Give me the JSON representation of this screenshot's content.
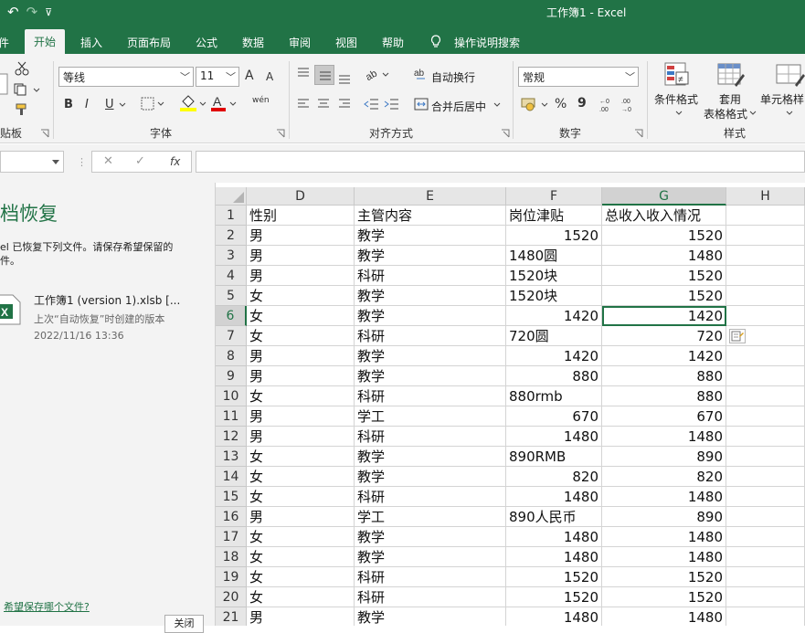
{
  "window": {
    "title": "工作簿1  -  Excel"
  },
  "qat": {
    "undo": "↶",
    "redo": "↷",
    "customize": "⊽"
  },
  "tabs": [
    "件",
    "开始",
    "插入",
    "页面布局",
    "公式",
    "数据",
    "审阅",
    "视图",
    "帮助",
    "操作说明搜索"
  ],
  "ribbon": {
    "clipboard": {
      "title": "贴板"
    },
    "font": {
      "name": "等线",
      "size": "11",
      "title": "字体",
      "bold": "B",
      "italic": "I",
      "underline": "U",
      "grow": "A",
      "shrink": "A",
      "wen": "wén"
    },
    "alignment": {
      "wrap": "自动换行",
      "merge": "合并后居中",
      "title": "对齐方式"
    },
    "number": {
      "format": "常规",
      "title": "数字",
      "percent": "%",
      "comma": "9"
    },
    "styles": {
      "conditional": "条件格式",
      "table_l1": "套用",
      "table_l2": "表格格式",
      "cell": "单元格样",
      "title": "样式"
    }
  },
  "formula_bar": {
    "fx": "fx",
    "cancel": "✕",
    "enter": "✓"
  },
  "recovery": {
    "title": "档恢复",
    "desc_l1": "el 已恢复下列文件。请保存希望保留的",
    "desc_l2": "件。",
    "file_name": "工作簿1 (version 1).xlsb  [...",
    "file_sub": "上次“自动恢复”时创建的版本",
    "file_time": "2022/11/16 13:36",
    "link": "希望保存哪个文件?",
    "close": "关闭"
  },
  "sheet": {
    "columns": [
      "D",
      "E",
      "F",
      "G",
      "H"
    ],
    "rows": [
      {
        "n": "1",
        "d": "性别",
        "e": "主管内容",
        "f": "岗位津贴",
        "f_num": false,
        "g": "总收入收入情况",
        "g_num": false
      },
      {
        "n": "2",
        "d": "男",
        "e": "教学",
        "f": "1520",
        "f_num": true,
        "g": "1520",
        "g_num": true
      },
      {
        "n": "3",
        "d": "男",
        "e": "教学",
        "f": "1480圆",
        "f_num": false,
        "g": "1480",
        "g_num": true
      },
      {
        "n": "4",
        "d": "男",
        "e": "科研",
        "f": "1520块",
        "f_num": false,
        "g": "1520",
        "g_num": true
      },
      {
        "n": "5",
        "d": "女",
        "e": "教学",
        "f": "1520块",
        "f_num": false,
        "g": "1520",
        "g_num": true
      },
      {
        "n": "6",
        "d": "女",
        "e": "教学",
        "f": "1420",
        "f_num": true,
        "g": "1420",
        "g_num": true
      },
      {
        "n": "7",
        "d": "女",
        "e": "科研",
        "f": "720圆",
        "f_num": false,
        "g": "720",
        "g_num": true
      },
      {
        "n": "8",
        "d": "男",
        "e": "教学",
        "f": "1420",
        "f_num": true,
        "g": "1420",
        "g_num": true
      },
      {
        "n": "9",
        "d": "男",
        "e": "教学",
        "f": "880",
        "f_num": true,
        "g": "880",
        "g_num": true
      },
      {
        "n": "10",
        "d": "女",
        "e": "科研",
        "f": "880rmb",
        "f_num": false,
        "g": "880",
        "g_num": true
      },
      {
        "n": "11",
        "d": "男",
        "e": "学工",
        "f": "670",
        "f_num": true,
        "g": "670",
        "g_num": true
      },
      {
        "n": "12",
        "d": "男",
        "e": "科研",
        "f": "1480",
        "f_num": true,
        "g": "1480",
        "g_num": true
      },
      {
        "n": "13",
        "d": "女",
        "e": "教学",
        "f": "890RMB",
        "f_num": false,
        "g": "890",
        "g_num": true
      },
      {
        "n": "14",
        "d": "女",
        "e": "教学",
        "f": "820",
        "f_num": true,
        "g": "820",
        "g_num": true
      },
      {
        "n": "15",
        "d": "女",
        "e": "科研",
        "f": "1480",
        "f_num": true,
        "g": "1480",
        "g_num": true
      },
      {
        "n": "16",
        "d": "男",
        "e": "学工",
        "f": "890人民币",
        "f_num": false,
        "g": "890",
        "g_num": true
      },
      {
        "n": "17",
        "d": "女",
        "e": "教学",
        "f": "1480",
        "f_num": true,
        "g": "1480",
        "g_num": true
      },
      {
        "n": "18",
        "d": "女",
        "e": "教学",
        "f": "1480",
        "f_num": true,
        "g": "1480",
        "g_num": true
      },
      {
        "n": "19",
        "d": "女",
        "e": "科研",
        "f": "1520",
        "f_num": true,
        "g": "1520",
        "g_num": true
      },
      {
        "n": "20",
        "d": "女",
        "e": "科研",
        "f": "1520",
        "f_num": true,
        "g": "1520",
        "g_num": true
      },
      {
        "n": "21",
        "d": "男",
        "e": "教学",
        "f": "1480",
        "f_num": true,
        "g": "1480",
        "g_num": true
      }
    ],
    "active_row": "6",
    "active_col": "G",
    "accent": "#217346"
  }
}
